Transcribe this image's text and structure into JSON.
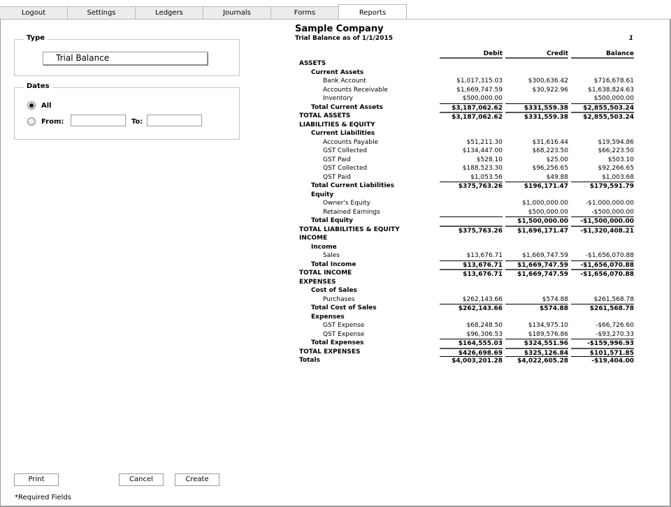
{
  "tabs": [
    {
      "label": "Logout",
      "active": false
    },
    {
      "label": "Settings",
      "active": false
    },
    {
      "label": "Ledgers",
      "active": false
    },
    {
      "label": "Journals",
      "active": false
    },
    {
      "label": "Forms",
      "active": false
    },
    {
      "label": "Reports",
      "active": true
    }
  ],
  "sidebar": {
    "type_legend": "Type",
    "type_value": "Trial Balance",
    "dates_legend": "Dates",
    "radio_all_label": "All",
    "radio_all_checked": true,
    "radio_from_label": "From:",
    "to_label": "To:",
    "from_value": "",
    "to_value": ""
  },
  "buttons": {
    "print": "Print",
    "cancel": "Cancel",
    "create": "Create"
  },
  "required_note": "*Required Fields",
  "report": {
    "company": "Sample Company",
    "subtitle": "Trial Balance as of 1/1/2015",
    "page": "1",
    "columns": [
      "Debit",
      "Credit",
      "Balance"
    ],
    "rows": [
      {
        "label": "ASSETS",
        "level": 0,
        "bold": true,
        "values": [
          "",
          "",
          ""
        ],
        "rule": ""
      },
      {
        "label": "Current Assets",
        "level": 1,
        "bold": true,
        "values": [
          "",
          "",
          ""
        ],
        "rule": ""
      },
      {
        "label": "Bank Account",
        "level": 2,
        "bold": false,
        "values": [
          "$1,017,315.03",
          "$300,636.42",
          "$716,678.61"
        ],
        "rule": ""
      },
      {
        "label": "Accounts Receivable",
        "level": 2,
        "bold": false,
        "values": [
          "$1,669,747.59",
          "$30,922.96",
          "$1,638,824.63"
        ],
        "rule": ""
      },
      {
        "label": "Inventory",
        "level": 2,
        "bold": false,
        "values": [
          "$500,000.00",
          "",
          "$500,000.00"
        ],
        "rule": ""
      },
      {
        "label": "Total Current Assets",
        "level": 1,
        "bold": true,
        "values": [
          "$3,187,062.62",
          "$331,559.38",
          "$2,855,503.24"
        ],
        "rule": "single"
      },
      {
        "label": "TOTAL ASSETS",
        "level": 0,
        "bold": true,
        "values": [
          "$3,187,062.62",
          "$331,559.38",
          "$2,855,503.24"
        ],
        "rule": "double"
      },
      {
        "label": "LIABILITIES & EQUITY",
        "level": 0,
        "bold": true,
        "values": [
          "",
          "",
          ""
        ],
        "rule": ""
      },
      {
        "label": "Current Liabilities",
        "level": 1,
        "bold": true,
        "values": [
          "",
          "",
          ""
        ],
        "rule": ""
      },
      {
        "label": "Accounts Payable",
        "level": 2,
        "bold": false,
        "values": [
          "$51,211.30",
          "$31,616.44",
          "$19,594.86"
        ],
        "rule": ""
      },
      {
        "label": "GST Collected",
        "level": 2,
        "bold": false,
        "values": [
          "$134,447.00",
          "$68,223.50",
          "$66,223.50"
        ],
        "rule": ""
      },
      {
        "label": "GST Paid",
        "level": 2,
        "bold": false,
        "values": [
          "$528.10",
          "$25.00",
          "$503.10"
        ],
        "rule": ""
      },
      {
        "label": "QST Collected",
        "level": 2,
        "bold": false,
        "values": [
          "$188,523.30",
          "$96,256.65",
          "$92,266.65"
        ],
        "rule": ""
      },
      {
        "label": "QST Paid",
        "level": 2,
        "bold": false,
        "values": [
          "$1,053.56",
          "$49.88",
          "$1,003.68"
        ],
        "rule": ""
      },
      {
        "label": "Total Current Liabilities",
        "level": 1,
        "bold": true,
        "values": [
          "$375,763.26",
          "$196,171.47",
          "$179,591.79"
        ],
        "rule": "single"
      },
      {
        "label": "Equity",
        "level": 1,
        "bold": true,
        "values": [
          "",
          "",
          ""
        ],
        "rule": ""
      },
      {
        "label": "Owner's Equity",
        "level": 2,
        "bold": false,
        "values": [
          "",
          "$1,000,000.00",
          "-$1,000,000.00"
        ],
        "rule": ""
      },
      {
        "label": "Retained Earnings",
        "level": 2,
        "bold": false,
        "values": [
          "",
          "$500,000.00",
          "-$500,000.00"
        ],
        "rule": ""
      },
      {
        "label": "Total Equity",
        "level": 1,
        "bold": true,
        "values": [
          "",
          "$1,500,000.00",
          "-$1,500,000.00"
        ],
        "rule": "single-all"
      },
      {
        "label": "TOTAL LIABILITIES & EQUITY",
        "level": 0,
        "bold": true,
        "values": [
          "$375,763.26",
          "$1,696,171.47",
          "-$1,320,408.21"
        ],
        "rule": "double"
      },
      {
        "label": "INCOME",
        "level": 0,
        "bold": true,
        "values": [
          "",
          "",
          ""
        ],
        "rule": ""
      },
      {
        "label": "Income",
        "level": 1,
        "bold": true,
        "values": [
          "",
          "",
          ""
        ],
        "rule": ""
      },
      {
        "label": "Sales",
        "level": 2,
        "bold": false,
        "values": [
          "$13,676.71",
          "$1,669,747.59",
          "-$1,656,070.88"
        ],
        "rule": ""
      },
      {
        "label": "Total Income",
        "level": 1,
        "bold": true,
        "values": [
          "$13,676.71",
          "$1,669,747.59",
          "-$1,656,070.88"
        ],
        "rule": "single"
      },
      {
        "label": "TOTAL INCOME",
        "level": 0,
        "bold": true,
        "values": [
          "$13,676.71",
          "$1,669,747.59",
          "-$1,656,070.88"
        ],
        "rule": "double"
      },
      {
        "label": "EXPENSES",
        "level": 0,
        "bold": true,
        "values": [
          "",
          "",
          ""
        ],
        "rule": ""
      },
      {
        "label": "Cost of Sales",
        "level": 1,
        "bold": true,
        "values": [
          "",
          "",
          ""
        ],
        "rule": ""
      },
      {
        "label": "Purchases",
        "level": 2,
        "bold": false,
        "values": [
          "$262,143.66",
          "$574.88",
          "$261,568.78"
        ],
        "rule": ""
      },
      {
        "label": "Total Cost of Sales",
        "level": 1,
        "bold": true,
        "values": [
          "$262,143.66",
          "$574.88",
          "$261,568.78"
        ],
        "rule": "single"
      },
      {
        "label": "Expenses",
        "level": 1,
        "bold": true,
        "values": [
          "",
          "",
          ""
        ],
        "rule": ""
      },
      {
        "label": "GST Expense",
        "level": 2,
        "bold": false,
        "values": [
          "$68,248.50",
          "$134,975.10",
          "-$66,726.60"
        ],
        "rule": ""
      },
      {
        "label": "QST Expense",
        "level": 2,
        "bold": false,
        "values": [
          "$96,306.53",
          "$189,576.86",
          "-$93,270.33"
        ],
        "rule": ""
      },
      {
        "label": "Total Expenses",
        "level": 1,
        "bold": true,
        "values": [
          "$164,555.03",
          "$324,551.96",
          "-$159,996.93"
        ],
        "rule": "single"
      },
      {
        "label": "TOTAL EXPENSES",
        "level": 0,
        "bold": true,
        "values": [
          "$426,698.69",
          "$325,126.84",
          "$101,571.85"
        ],
        "rule": "double"
      },
      {
        "label": "Totals",
        "level": 0,
        "bold": true,
        "values": [
          "$4,003,201.28",
          "$4,022,605.28",
          "-$19,404.00"
        ],
        "rule": "single"
      }
    ]
  }
}
